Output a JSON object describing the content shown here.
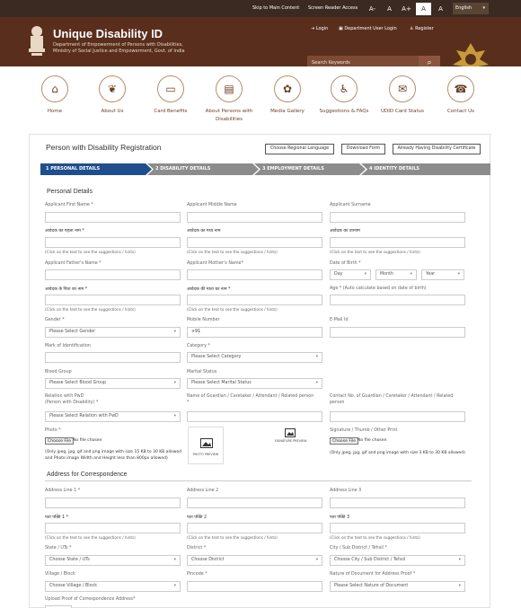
{
  "topbar": {
    "skip": "Skip to Main Content",
    "screen_reader": "Screen Reader Access",
    "font_small": "A-",
    "font_normal": "A",
    "font_large": "A+",
    "theme_light": "A",
    "theme_dark": "A",
    "language": "English"
  },
  "header": {
    "title": "Unique Disability ID",
    "subtitle_line1": "Department of Empowerment of Persons with Disabilities,",
    "subtitle_line2": "Ministry of Social Justice and Empowerment, Govt. of India",
    "login": "Login",
    "dept_login": "Department User Login",
    "register": "Register",
    "search_placeholder": "Search Keywords"
  },
  "nav": [
    {
      "label": "Home",
      "icon": "home-icon"
    },
    {
      "label": "About Us",
      "icon": "leaf-icon"
    },
    {
      "label": "Card Benefits",
      "icon": "card-icon"
    },
    {
      "label": "About Persons with Disabilities",
      "icon": "id-icon"
    },
    {
      "label": "Media Gallery",
      "icon": "gallery-icon"
    },
    {
      "label": "Suggestions & FAQs",
      "icon": "wheelchair-icon"
    },
    {
      "label": "UDID Card Status",
      "icon": "status-icon"
    },
    {
      "label": "Contact Us",
      "icon": "phone-icon"
    }
  ],
  "form": {
    "title": "Person with Disability Registration",
    "btn_regional": "Choose Regional Language",
    "btn_download": "Download Form",
    "btn_certificate": "Already Having Disability Certificate",
    "steps": [
      "1  PERSONAL DETAILS",
      "2  DISABILITY DETAILS",
      "3  EMPLOYMENT DETAILS",
      "4  IDENTITY DETAILS"
    ],
    "personal_details": "Personal Details",
    "first_name": "Applicant First Name *",
    "middle_name": "Applicant Middle Name",
    "surname": "Applicant Surname",
    "first_name_hi": "आवेदक का पहला नाम *",
    "middle_name_hi": "आवेदक का मध्य नाम",
    "surname_hi": "आवेदक का उपनाम",
    "hint": "(Click on the text to see the suggestions / hints)",
    "father_name": "Applicant Father's Name *",
    "mother_name": "Applicant Mother's Name*",
    "dob": "Date of Birth *",
    "day": "Day",
    "month": "Month",
    "year": "Year",
    "father_name_hi": "आवेदक के पिता का नाम *",
    "mother_name_hi": "आवेदक की माता का नाम *",
    "age": "Age * (Auto calculate based on date of birth)",
    "gender": "Gender *",
    "gender_ph": "Please Select Gender",
    "mobile": "Mobile Number",
    "mobile_val": "+91",
    "email": "E-Mail Id",
    "identification": "Mark of Identification",
    "category": "Category *",
    "category_ph": "Please Select Category",
    "blood_group": "Blood Group",
    "blood_ph": "Please Select Blood Group",
    "marital": "Marital Status",
    "marital_ph": "Please Select Marital Status",
    "relation": "Relation with PwD",
    "relation2": "(Person with Disability) *",
    "relation_ph": "Please Select Relation with PwD",
    "guardian": "Name of Guardian / Caretaker / Attendant / Related person",
    "guardian2": "*",
    "guardian_contact": "Contact No. of Guardian / Caretaker / Attendant / Related",
    "guardian_contact2": "person",
    "photo": "Photo *",
    "choose_file": "Choose File",
    "no_file": "No file chosen",
    "photo_note1": "(Only jpeg, jpg, gif and png image with size 15 KB to 30 KB allowed",
    "photo_note2": "and Photo image Width and Height less than 800px allowed)",
    "photo_preview": "PHOTO PREVIEW",
    "sign_preview": "SIGNATURE PREVIEW",
    "signature": "Signature / Thumb / Other Print",
    "sign_note": "(Only jpeg, jpg, gif and png image with size 3 KB to 30 KB allowed)",
    "address_section": "Address for Correspondence",
    "addr1": "Address Line 1 *",
    "addr2": "Address Line 2",
    "addr3": "Address Line 3",
    "addr1_hi": "पता पंक्ति 1 *",
    "addr2_hi": "पता पंक्ति 2",
    "addr3_hi": "पता पंक्ति 3",
    "state": "State / UTs *",
    "state_ph": "Choose State / UTs",
    "district": "District *",
    "district_ph": "Choose District",
    "city": "City / Sub District / Tehsil *",
    "city_ph": "Choose City / Sub District / Tehsil",
    "village": "Village / Block",
    "village_ph": "Choose Village / Block",
    "pincode": "Pincode *",
    "nature": "Nature of Document for Address Proof *",
    "nature_ph": "Please Select Nature of Document",
    "upload_proof": "Upload Proof of Correspondence Address*"
  }
}
